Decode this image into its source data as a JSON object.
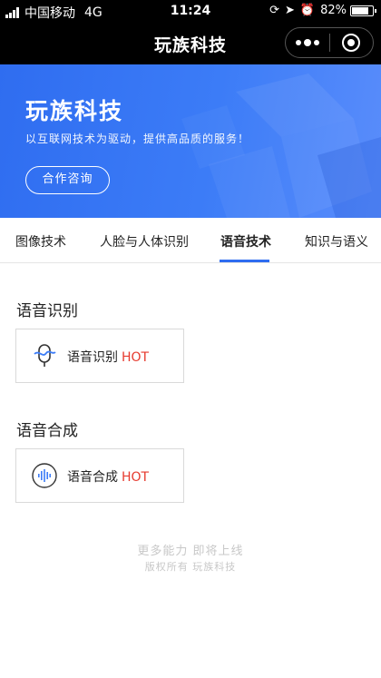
{
  "status_bar": {
    "carrier": "中国移动",
    "network": "4G",
    "time": "11:24",
    "battery": "82%",
    "battery_level": 0.82,
    "signal_bars": 4
  },
  "nav": {
    "title": "玩族科技"
  },
  "banner": {
    "title": "玩族科技",
    "subtitle": "以互联网技术为驱动，提供高品质的服务！",
    "button_label": "合作咨询",
    "gradient_start": "#2f6df0",
    "gradient_end": "#5a8dfb"
  },
  "tabs": [
    {
      "label": "图像技术",
      "active": false
    },
    {
      "label": "人脸与人体识别",
      "active": false
    },
    {
      "label": "语音技术",
      "active": true
    },
    {
      "label": "知识与语义",
      "active": false
    }
  ],
  "sections": [
    {
      "title": "语音识别",
      "card": {
        "label": "语音识别",
        "badge": "HOT",
        "icon": "microphone-icon"
      }
    },
    {
      "title": "语音合成",
      "card": {
        "label": "语音合成",
        "badge": "HOT",
        "icon": "sound-wave-icon"
      }
    }
  ],
  "footer": {
    "more": "更多能力 即将上线",
    "copyright": "版权所有 玩族科技"
  },
  "colors": {
    "accent": "#2f6df0",
    "hot": "#e63a2e"
  }
}
